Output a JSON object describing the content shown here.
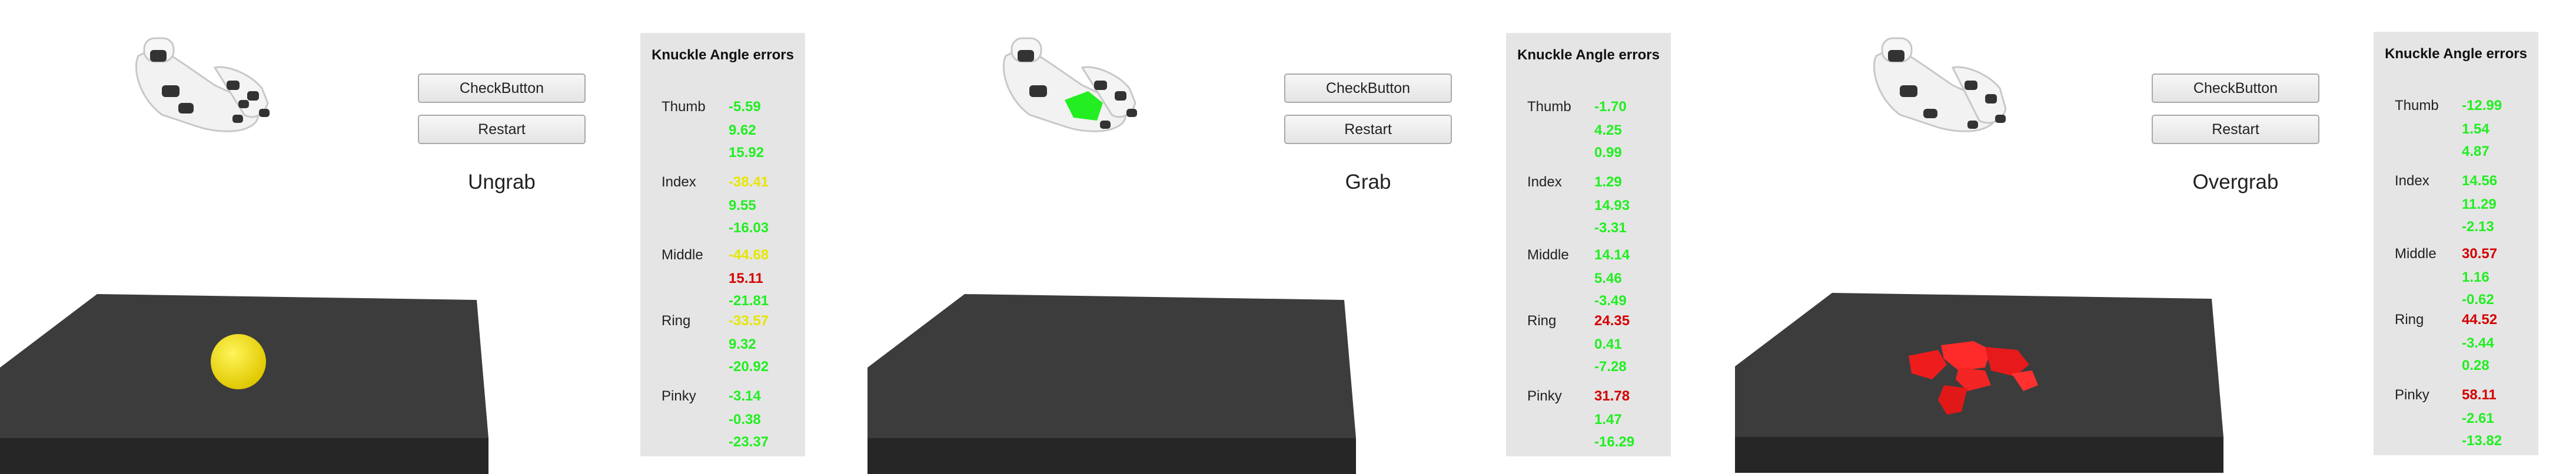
{
  "panels": [
    {
      "state_label": "Ungrab",
      "buttons": {
        "check": "CheckButton",
        "restart": "Restart"
      },
      "object": "yellow-ball",
      "errors": {
        "title": "Knuckle Angle errors",
        "fingers": [
          {
            "name": "Thumb",
            "values": [
              "-5.59",
              "9.62",
              "15.92"
            ],
            "colors": [
              "green",
              "green",
              "green"
            ]
          },
          {
            "name": "Index",
            "values": [
              "-38.41",
              "9.55",
              "-16.03"
            ],
            "colors": [
              "yellow",
              "green",
              "green"
            ]
          },
          {
            "name": "Middle",
            "values": [
              "-44.68",
              "15.11",
              "-21.81"
            ],
            "colors": [
              "yellow",
              "red",
              "green"
            ]
          },
          {
            "name": "Ring",
            "values": [
              "-33.57",
              "9.32",
              "-20.92"
            ],
            "colors": [
              "yellow",
              "green",
              "green"
            ]
          },
          {
            "name": "Pinky",
            "values": [
              "-3.14",
              "-0.38",
              "-23.37"
            ],
            "colors": [
              "green",
              "green",
              "green"
            ]
          }
        ]
      }
    },
    {
      "state_label": "Grab",
      "buttons": {
        "check": "CheckButton",
        "restart": "Restart"
      },
      "object": "green-in-hand",
      "errors": {
        "title": "Knuckle Angle errors",
        "fingers": [
          {
            "name": "Thumb",
            "values": [
              "-1.70",
              "4.25",
              "0.99"
            ],
            "colors": [
              "green",
              "green",
              "green"
            ]
          },
          {
            "name": "Index",
            "values": [
              "1.29",
              "14.93",
              "-3.31"
            ],
            "colors": [
              "green",
              "green",
              "green"
            ]
          },
          {
            "name": "Middle",
            "values": [
              "14.14",
              "5.46",
              "-3.49"
            ],
            "colors": [
              "green",
              "green",
              "green"
            ]
          },
          {
            "name": "Ring",
            "values": [
              "24.35",
              "0.41",
              "-7.28"
            ],
            "colors": [
              "red",
              "green",
              "green"
            ]
          },
          {
            "name": "Pinky",
            "values": [
              "31.78",
              "1.47",
              "-16.29"
            ],
            "colors": [
              "red",
              "green",
              "green"
            ]
          }
        ]
      }
    },
    {
      "state_label": "Overgrab",
      "buttons": {
        "check": "CheckButton",
        "restart": "Restart"
      },
      "object": "red-fragments",
      "errors": {
        "title": "Knuckle Angle errors",
        "fingers": [
          {
            "name": "Thumb",
            "values": [
              "-12.99",
              "1.54",
              "4.87"
            ],
            "colors": [
              "green",
              "green",
              "green"
            ]
          },
          {
            "name": "Index",
            "values": [
              "14.56",
              "11.29",
              "-2.13"
            ],
            "colors": [
              "green",
              "green",
              "green"
            ]
          },
          {
            "name": "Middle",
            "values": [
              "30.57",
              "1.16",
              "-0.62"
            ],
            "colors": [
              "red",
              "green",
              "green"
            ]
          },
          {
            "name": "Ring",
            "values": [
              "44.52",
              "-3.44",
              "0.28"
            ],
            "colors": [
              "red",
              "green",
              "green"
            ]
          },
          {
            "name": "Pinky",
            "values": [
              "58.11",
              "-2.61",
              "-13.82"
            ],
            "colors": [
              "red",
              "green",
              "green"
            ]
          }
        ]
      }
    }
  ]
}
